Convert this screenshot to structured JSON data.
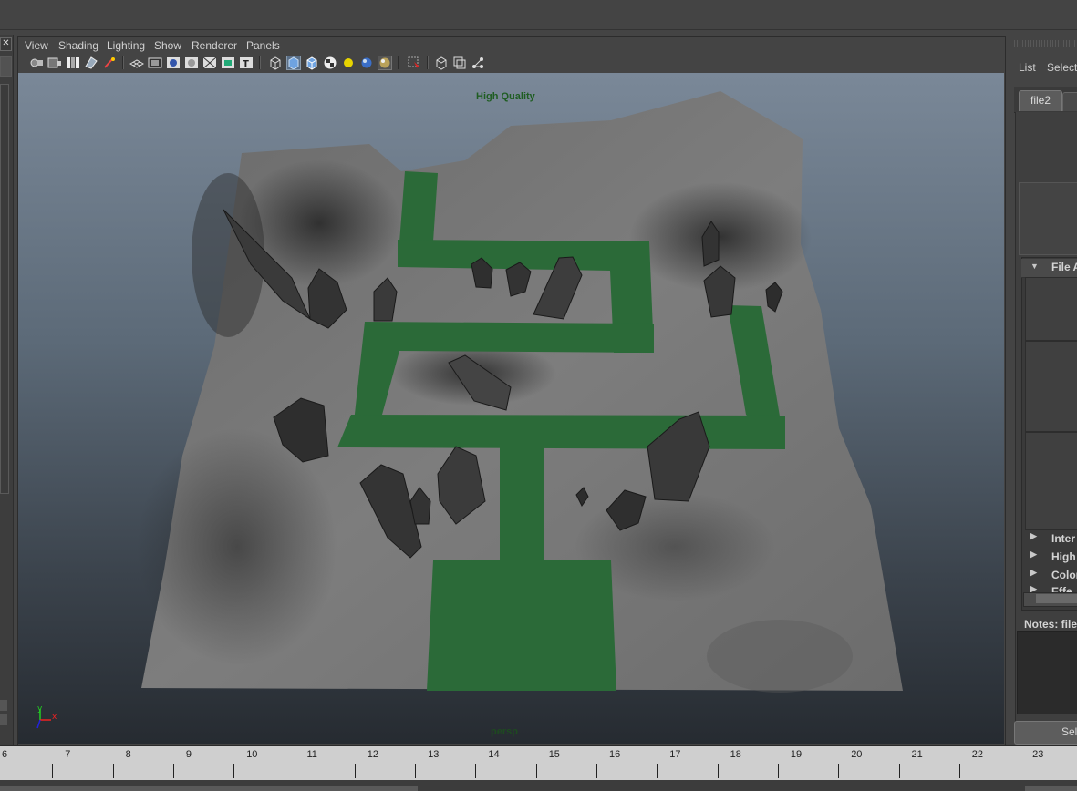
{
  "panel_menu": [
    "View",
    "Shading",
    "Lighting",
    "Show",
    "Renderer",
    "Panels"
  ],
  "toolbar_icons": [
    "camera-select-icon",
    "camera-attributes-icon",
    "bookmarks-icon",
    "image-plane-icon",
    "2d-pan-zoom-icon",
    "grid-icon",
    "film-gate-icon",
    "resolution-gate-icon",
    "gate-mask-icon",
    "field-chart-icon",
    "safe-action-icon",
    "safe-title-icon",
    "wireframe-icon",
    "smooth-shade-icon",
    "wireframe-on-shaded-icon",
    "textured-icon",
    "use-all-lights-icon",
    "shadows-icon",
    "ambient-occlusion-icon",
    "isolate-select-icon",
    "xray-icon",
    "xray-active-components-icon",
    "xray-joints-icon"
  ],
  "viewport": {
    "quality_label": "High Quality",
    "camera_label": "persp",
    "axis_x": "x",
    "axis_y": "y"
  },
  "attribute_editor": {
    "menu_list": "List",
    "menu_selected": "Selecte",
    "tab_file2": "file2",
    "section_file_attributes": "File A",
    "sections": [
      "Inter",
      "High",
      "Color",
      "Effe"
    ],
    "notes_label": "Notes: file",
    "select_button": "Sele"
  },
  "timeline": {
    "ticks": [
      "6",
      "7",
      "8",
      "9",
      "10",
      "11",
      "12",
      "13",
      "14",
      "15",
      "16",
      "17",
      "18",
      "19",
      "20",
      "21",
      "22",
      "23"
    ]
  },
  "colors": {
    "path_green": "#2b6a38",
    "terrain_gray": "#777777",
    "crystal_dark": "#2e2e2e"
  }
}
